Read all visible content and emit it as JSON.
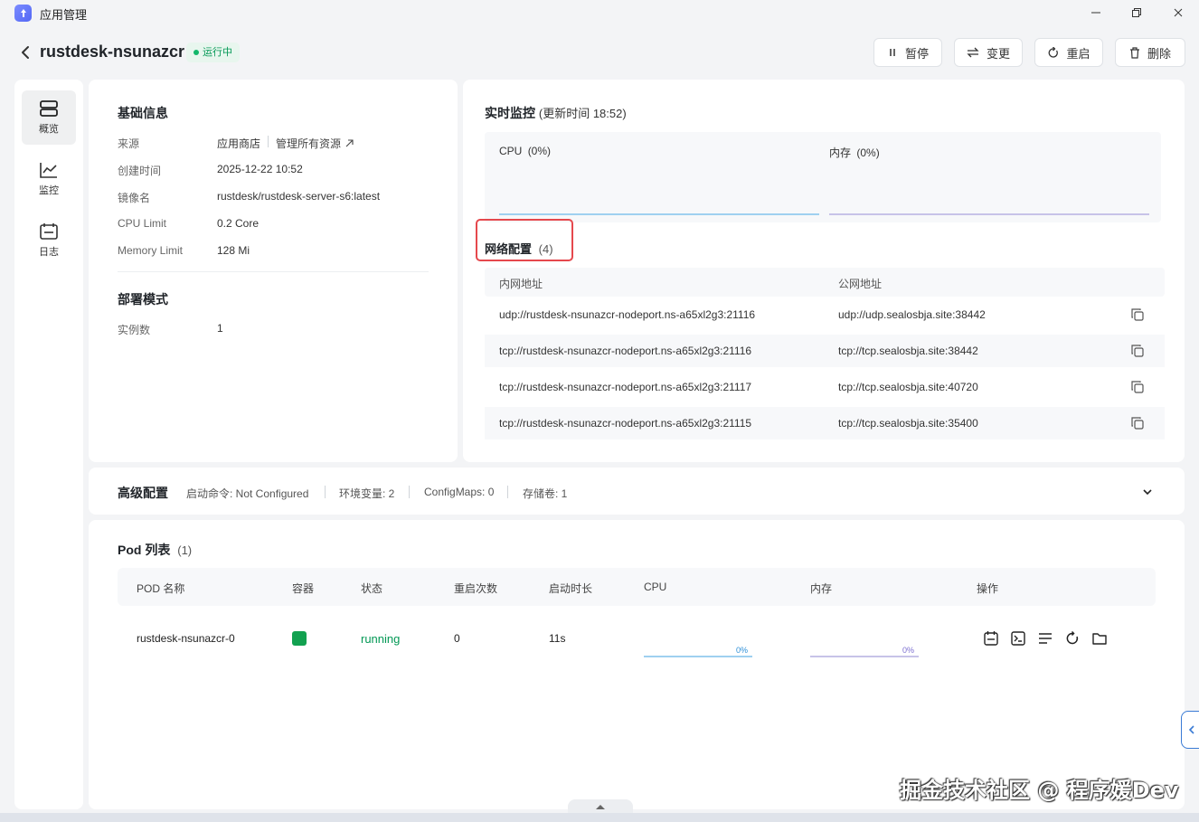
{
  "window": {
    "title": "应用管理",
    "controls": {
      "minimize": "minimize-icon",
      "maximize": "restore-icon",
      "close": "close-icon"
    }
  },
  "header": {
    "app_name": "rustdesk-nsunazcr",
    "status": "运行中",
    "buttons": {
      "pause": "暂停",
      "change": "变更",
      "restart": "重启",
      "delete": "删除"
    }
  },
  "sidebar": {
    "items": [
      {
        "label": "概览",
        "icon": "overview-icon",
        "active": true
      },
      {
        "label": "监控",
        "icon": "chart-icon",
        "active": false
      },
      {
        "label": "日志",
        "icon": "calendar-log-icon",
        "active": false
      }
    ]
  },
  "basic_info": {
    "title": "基础信息",
    "rows": [
      {
        "label": "来源",
        "value": "应用商店",
        "link": "管理所有资源"
      },
      {
        "label": "创建时间",
        "value": "2025-12-22 10:52"
      },
      {
        "label": "镜像名",
        "value": "rustdesk/rustdesk-server-s6:latest"
      },
      {
        "label": "CPU Limit",
        "value": "0.2 Core"
      },
      {
        "label": "Memory Limit",
        "value": "128 Mi"
      }
    ],
    "deploy_title": "部署模式",
    "deploy_rows": [
      {
        "label": "实例数",
        "value": "1"
      }
    ]
  },
  "monitor": {
    "title": "实时监控",
    "update_time": "(更新时间  18:52)",
    "cpu_label": "CPU",
    "cpu_value": "(0%)",
    "mem_label": "内存",
    "mem_value": "(0%)"
  },
  "network": {
    "title": "网络配置",
    "count": "(4)",
    "col_internal": "内网地址",
    "col_public": "公网地址",
    "rows": [
      {
        "internal": "udp://rustdesk-nsunazcr-nodeport.ns-a65xl2g3:21116",
        "public": "udp://udp.sealosbja.site:38442"
      },
      {
        "internal": "tcp://rustdesk-nsunazcr-nodeport.ns-a65xl2g3:21116",
        "public": "tcp://tcp.sealosbja.site:38442"
      },
      {
        "internal": "tcp://rustdesk-nsunazcr-nodeport.ns-a65xl2g3:21117",
        "public": "tcp://tcp.sealosbja.site:40720"
      },
      {
        "internal": "tcp://rustdesk-nsunazcr-nodeport.ns-a65xl2g3:21115",
        "public": "tcp://tcp.sealosbja.site:35400"
      }
    ]
  },
  "advanced": {
    "title": "高级配置",
    "start_cmd": "启动命令: Not Configured",
    "env": "环境变量: 2",
    "configmaps": "ConfigMaps: 0",
    "storage": "存储卷: 1"
  },
  "pods": {
    "title": "Pod 列表",
    "count": "(1)",
    "columns": [
      "POD 名称",
      "容器",
      "状态",
      "重启次数",
      "启动时长",
      "CPU",
      "内存",
      "操作"
    ],
    "rows": [
      {
        "name": "rustdesk-nsunazcr-0",
        "status": "running",
        "restarts": "0",
        "uptime": "11s",
        "cpu_pct": "0%",
        "mem_pct": "0%"
      }
    ]
  },
  "watermark": "掘金技术社区 @ 程序媛Dev",
  "colors": {
    "accent_green": "#12b76a",
    "running_text": "#039855",
    "highlight_red": "#e5484d"
  }
}
